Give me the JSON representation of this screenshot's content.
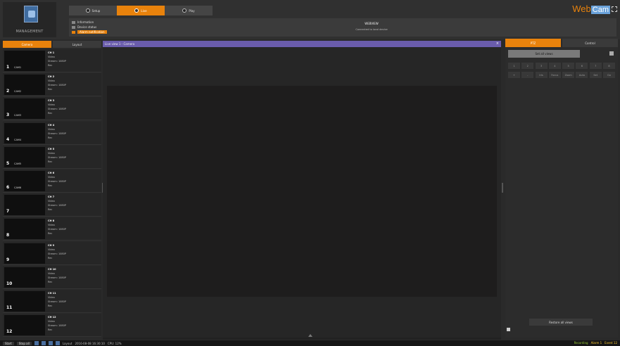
{
  "header": {
    "logo_text": "MANAGEMENT",
    "modes": [
      {
        "label": "Setup",
        "icon": "setup-icon",
        "active": false
      },
      {
        "label": "Live",
        "icon": "live-icon",
        "active": true
      },
      {
        "label": "Play",
        "icon": "play-icon",
        "active": false
      }
    ],
    "info_rows": [
      "Information",
      "Device status",
      "Alarm notification"
    ],
    "center_title": "WEBVIEW",
    "center_subtitle": "Connected to local device",
    "brand_prefix": "Web",
    "brand_suffix": "Cam"
  },
  "left_panel": {
    "tabs": [
      "Camera",
      "Layout"
    ],
    "cameras": [
      {
        "num": "1",
        "name": "CAM1",
        "title": "CH 1",
        "lines": [
          "Video",
          "Stream: 1080P",
          "Rec"
        ]
      },
      {
        "num": "2",
        "name": "CAM2",
        "title": "CH 2",
        "lines": [
          "Video",
          "Stream: 1080P",
          "Rec"
        ]
      },
      {
        "num": "3",
        "name": "CAM3",
        "title": "CH 3",
        "lines": [
          "Video",
          "Stream: 1080P",
          "Rec"
        ]
      },
      {
        "num": "4",
        "name": "CAM4",
        "title": "CH 4",
        "lines": [
          "Video",
          "Stream: 1080P",
          "Rec"
        ]
      },
      {
        "num": "5",
        "name": "CAM5",
        "title": "CH 5",
        "lines": [
          "Video",
          "Stream: 1080P",
          "Rec"
        ]
      },
      {
        "num": "6",
        "name": "CAM6",
        "title": "CH 6",
        "lines": [
          "Video",
          "Stream: 1080P",
          "Rec"
        ]
      },
      {
        "num": "7",
        "name": "",
        "title": "CH 7",
        "lines": [
          "Video",
          "Stream: 1080P",
          "Rec"
        ]
      },
      {
        "num": "8",
        "name": "",
        "title": "CH 8",
        "lines": [
          "Video",
          "Stream: 1080P",
          "Rec"
        ]
      },
      {
        "num": "9",
        "name": "",
        "title": "CH 9",
        "lines": [
          "Video",
          "Stream: 1080P",
          "Rec"
        ]
      },
      {
        "num": "10",
        "name": "",
        "title": "CH 10",
        "lines": [
          "Video",
          "Stream: 1080P",
          "Rec"
        ]
      },
      {
        "num": "11",
        "name": "",
        "title": "CH 11",
        "lines": [
          "Video",
          "Stream: 1080P",
          "Rec"
        ]
      },
      {
        "num": "12",
        "name": "",
        "title": "CH 12",
        "lines": [
          "Video",
          "Stream: 1080P",
          "Rec"
        ]
      }
    ]
  },
  "center": {
    "title": "Live view 1 - Camera",
    "close": "×"
  },
  "right_panel": {
    "tabs": [
      "PTZ",
      "Control"
    ],
    "bulk_button": "Set all views",
    "grid_row1": [
      "1",
      "2",
      "3",
      "4",
      "5",
      "6",
      "7",
      "8"
    ],
    "grid_row2": [
      "+",
      "-",
      "Iris",
      "Focus",
      "Zoom",
      "Auto",
      "Set",
      "Go"
    ],
    "bottom_button": "Restore all views"
  },
  "statusbar": {
    "btn1": "Start",
    "btn2": "Stop all",
    "text1": "Layout",
    "text2": "2016-08-08 16:30:10",
    "text3": "CPU: 12%",
    "right1": "Recording",
    "right2": "Alarm 1",
    "right3": "Event 12"
  }
}
